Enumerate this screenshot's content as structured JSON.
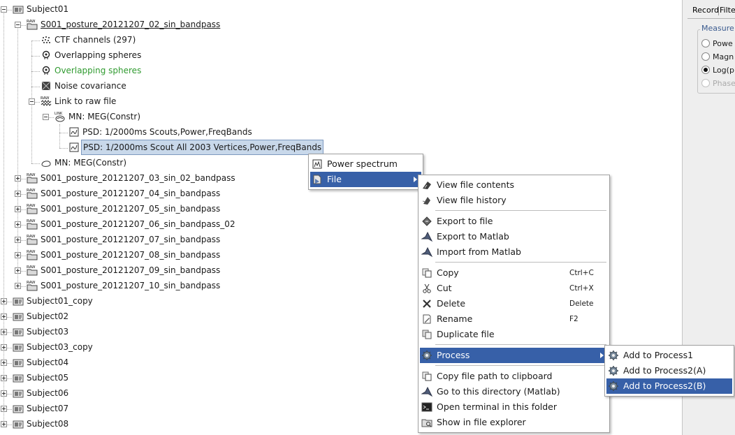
{
  "tree": {
    "nodes": [
      {
        "name": "Subject01",
        "icon": "subject-icon"
      },
      {
        "name": "S001_posture_20121207_02_sin_bandpass",
        "icon": "raw-folder-icon",
        "underlined": true
      },
      {
        "name": "CTF channels (297)",
        "icon": "channels-icon"
      },
      {
        "name": "Overlapping spheres",
        "icon": "head-model-icon"
      },
      {
        "name": "Overlapping spheres",
        "icon": "head-model-icon",
        "color": "#2f9a2f"
      },
      {
        "name": "Noise covariance",
        "icon": "noise-covariance-icon"
      },
      {
        "name": "Link to raw file",
        "icon": "raw-link-icon"
      },
      {
        "name": "MN: MEG(Constr)",
        "icon": "link-sources-icon"
      },
      {
        "name": "PSD: 1/2000ms Scouts,Power,FreqBands",
        "icon": "timefreq-icon"
      },
      {
        "name": "PSD: 1/2000ms Scout All 2003 Vertices,Power,FreqBands",
        "icon": "timefreq-icon",
        "selected": true
      },
      {
        "name": "MN: MEG(Constr)",
        "icon": "sources-icon"
      },
      {
        "name": "S001_posture_20121207_03_sin_02_bandpass",
        "icon": "raw-folder-icon"
      },
      {
        "name": "S001_posture_20121207_04_sin_bandpass",
        "icon": "raw-folder-icon"
      },
      {
        "name": "S001_posture_20121207_05_sin_bandpass",
        "icon": "raw-folder-icon"
      },
      {
        "name": "S001_posture_20121207_06_sin_bandpass_02",
        "icon": "raw-folder-icon"
      },
      {
        "name": "S001_posture_20121207_07_sin_bandpass",
        "icon": "raw-folder-icon"
      },
      {
        "name": "S001_posture_20121207_08_sin_bandpass",
        "icon": "raw-folder-icon"
      },
      {
        "name": "S001_posture_20121207_09_sin_bandpass",
        "icon": "raw-folder-icon"
      },
      {
        "name": "S001_posture_20121207_10_sin_bandpass",
        "icon": "raw-folder-icon"
      },
      {
        "name": "Subject01_copy",
        "icon": "subject-icon"
      },
      {
        "name": "Subject02",
        "icon": "subject-icon"
      },
      {
        "name": "Subject03",
        "icon": "subject-icon"
      },
      {
        "name": "Subject03_copy",
        "icon": "subject-icon"
      },
      {
        "name": "Subject04",
        "icon": "subject-icon"
      },
      {
        "name": "Subject05",
        "icon": "subject-icon"
      },
      {
        "name": "Subject06",
        "icon": "subject-icon"
      },
      {
        "name": "Subject07",
        "icon": "subject-icon"
      },
      {
        "name": "Subject08",
        "icon": "subject-icon"
      }
    ]
  },
  "right_panel": {
    "tabs": [
      "Record",
      "Filte"
    ],
    "group_title": "Measure",
    "options": [
      {
        "label": "Powe",
        "checked": false,
        "disabled": false
      },
      {
        "label": "Magn",
        "checked": false,
        "disabled": false
      },
      {
        "label": "Log(p",
        "checked": true,
        "disabled": false
      },
      {
        "label": "Phase",
        "checked": false,
        "disabled": true
      }
    ]
  },
  "menus": {
    "context": {
      "items": [
        {
          "label": "Power spectrum",
          "icon": "power-spectrum-icon"
        },
        {
          "label": "File",
          "icon": "file-icon",
          "submenu": true,
          "highlighted": true
        }
      ]
    },
    "file": {
      "items": [
        {
          "label": "View file contents",
          "icon": "view-contents-icon"
        },
        {
          "label": "View file history",
          "icon": "history-icon"
        },
        {
          "separator": true
        },
        {
          "label": "Export to file",
          "icon": "export-icon"
        },
        {
          "label": "Export to Matlab",
          "icon": "matlab-icon"
        },
        {
          "label": "Import from Matlab",
          "icon": "matlab-icon"
        },
        {
          "separator": true
        },
        {
          "label": "Copy",
          "icon": "copy-icon",
          "shortcut": "Ctrl+C"
        },
        {
          "label": "Cut",
          "icon": "cut-icon",
          "shortcut": "Ctrl+X"
        },
        {
          "label": "Delete",
          "icon": "delete-icon",
          "shortcut": "Delete"
        },
        {
          "label": "Rename",
          "icon": "rename-icon",
          "shortcut": "F2"
        },
        {
          "label": "Duplicate file",
          "icon": "duplicate-icon"
        },
        {
          "separator": true
        },
        {
          "label": "Process",
          "icon": "gear-icon",
          "submenu": true,
          "highlighted": true
        },
        {
          "separator": true
        },
        {
          "label": "Copy file path to clipboard",
          "icon": "copy-icon"
        },
        {
          "label": "Go to this directory (Matlab)",
          "icon": "matlab-icon"
        },
        {
          "label": "Open terminal in this folder",
          "icon": "terminal-icon"
        },
        {
          "label": "Show in file explorer",
          "icon": "explorer-icon"
        }
      ]
    },
    "process": {
      "items": [
        {
          "label": "Add to Process1",
          "icon": "gear-icon"
        },
        {
          "label": "Add to Process2(A)",
          "icon": "gear-icon"
        },
        {
          "label": "Add to Process2(B)",
          "icon": "gear-icon",
          "highlighted": true
        }
      ]
    }
  },
  "colors": {
    "highlight": "#3760a8",
    "selection": "#c8d8ea",
    "green_text": "#2f9a2f",
    "group_title": "#3b5b8f"
  }
}
